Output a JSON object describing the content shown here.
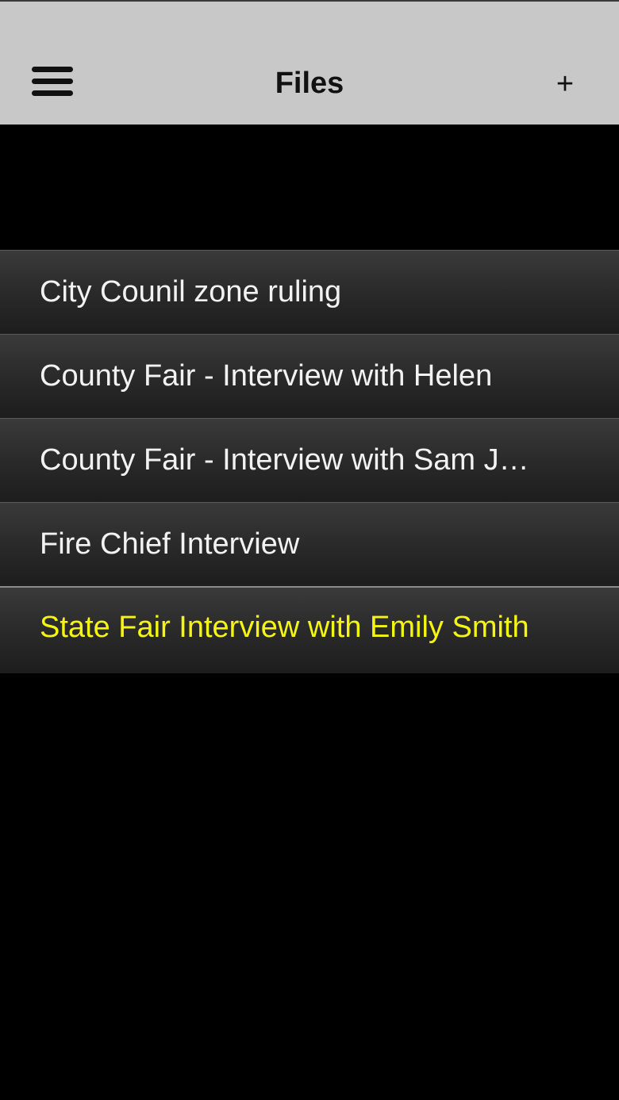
{
  "header": {
    "title": "Files",
    "menu_icon": "hamburger-menu-icon",
    "add_label": "+"
  },
  "files": [
    {
      "label": "City Counil zone ruling"
    },
    {
      "label": "County Fair - Interview with Helen"
    },
    {
      "label": "County Fair - Interview with Sam J…"
    },
    {
      "label": "Fire Chief Interview"
    },
    {
      "label": "State Fair Interview with Emily Smith",
      "selected": true
    }
  ],
  "colors": {
    "navbar_background": "#c8c8c8",
    "background": "#000000",
    "row_text": "#f2f2f2",
    "selected_text": "#f5f514"
  }
}
